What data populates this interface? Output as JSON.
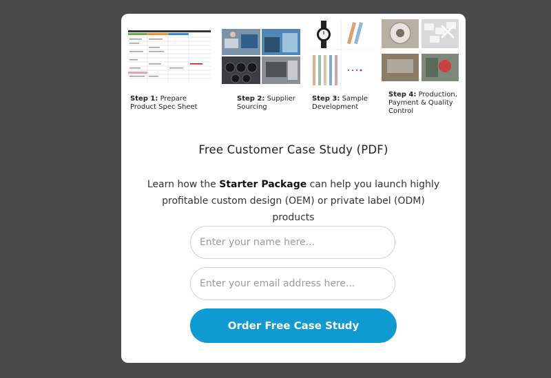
{
  "modal": {
    "close_icon": "close-icon",
    "steps": [
      {
        "label": "Step 1:",
        "text": "Prepare Product Spec Sheet"
      },
      {
        "label": "Step 2:",
        "text": "Supplier Sourcing"
      },
      {
        "label": "Step 3:",
        "text": "Sample Development"
      },
      {
        "label": "Step 4:",
        "text": "Production, Payment & Quality Control"
      }
    ],
    "title": "Free Customer Case Study (PDF)",
    "description": {
      "before": "Learn how the ",
      "bold": "Starter Package",
      "after": " can help you launch highly profitable custom design (OEM) or private label (ODM) products"
    },
    "form": {
      "name_placeholder": "Enter your name here...",
      "email_placeholder": "Enter your email address here...",
      "submit_label": "Order Free Case Study"
    },
    "colors": {
      "overlay": "#4a4a4a",
      "button": "#0f9ad2"
    }
  }
}
